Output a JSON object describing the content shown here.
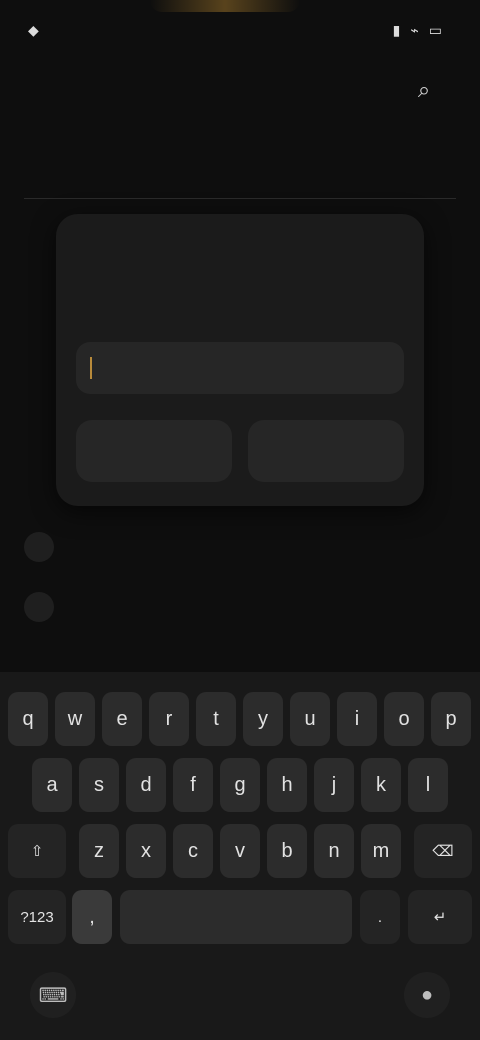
{
  "status": {
    "time": "",
    "battery": ""
  },
  "page": {
    "title": ""
  },
  "dialog": {
    "title": "",
    "description": "",
    "input_placeholder": "",
    "cancel_label": "",
    "ok_label": ""
  },
  "keyboard": {
    "row1": [
      "q",
      "w",
      "e",
      "r",
      "t",
      "y",
      "u",
      "i",
      "o",
      "p"
    ],
    "row2": [
      "a",
      "s",
      "d",
      "f",
      "g",
      "h",
      "j",
      "k",
      "l"
    ],
    "row3": [
      "z",
      "x",
      "c",
      "v",
      "b",
      "n",
      "m"
    ],
    "row4": {
      "mode": "?123",
      "comma": ",",
      "space": "",
      "period": ".",
      "enter": ""
    }
  },
  "colors": {
    "accent": "#b88a3a",
    "background": "#0e0e0e",
    "dialog": "#1b1b1b"
  }
}
